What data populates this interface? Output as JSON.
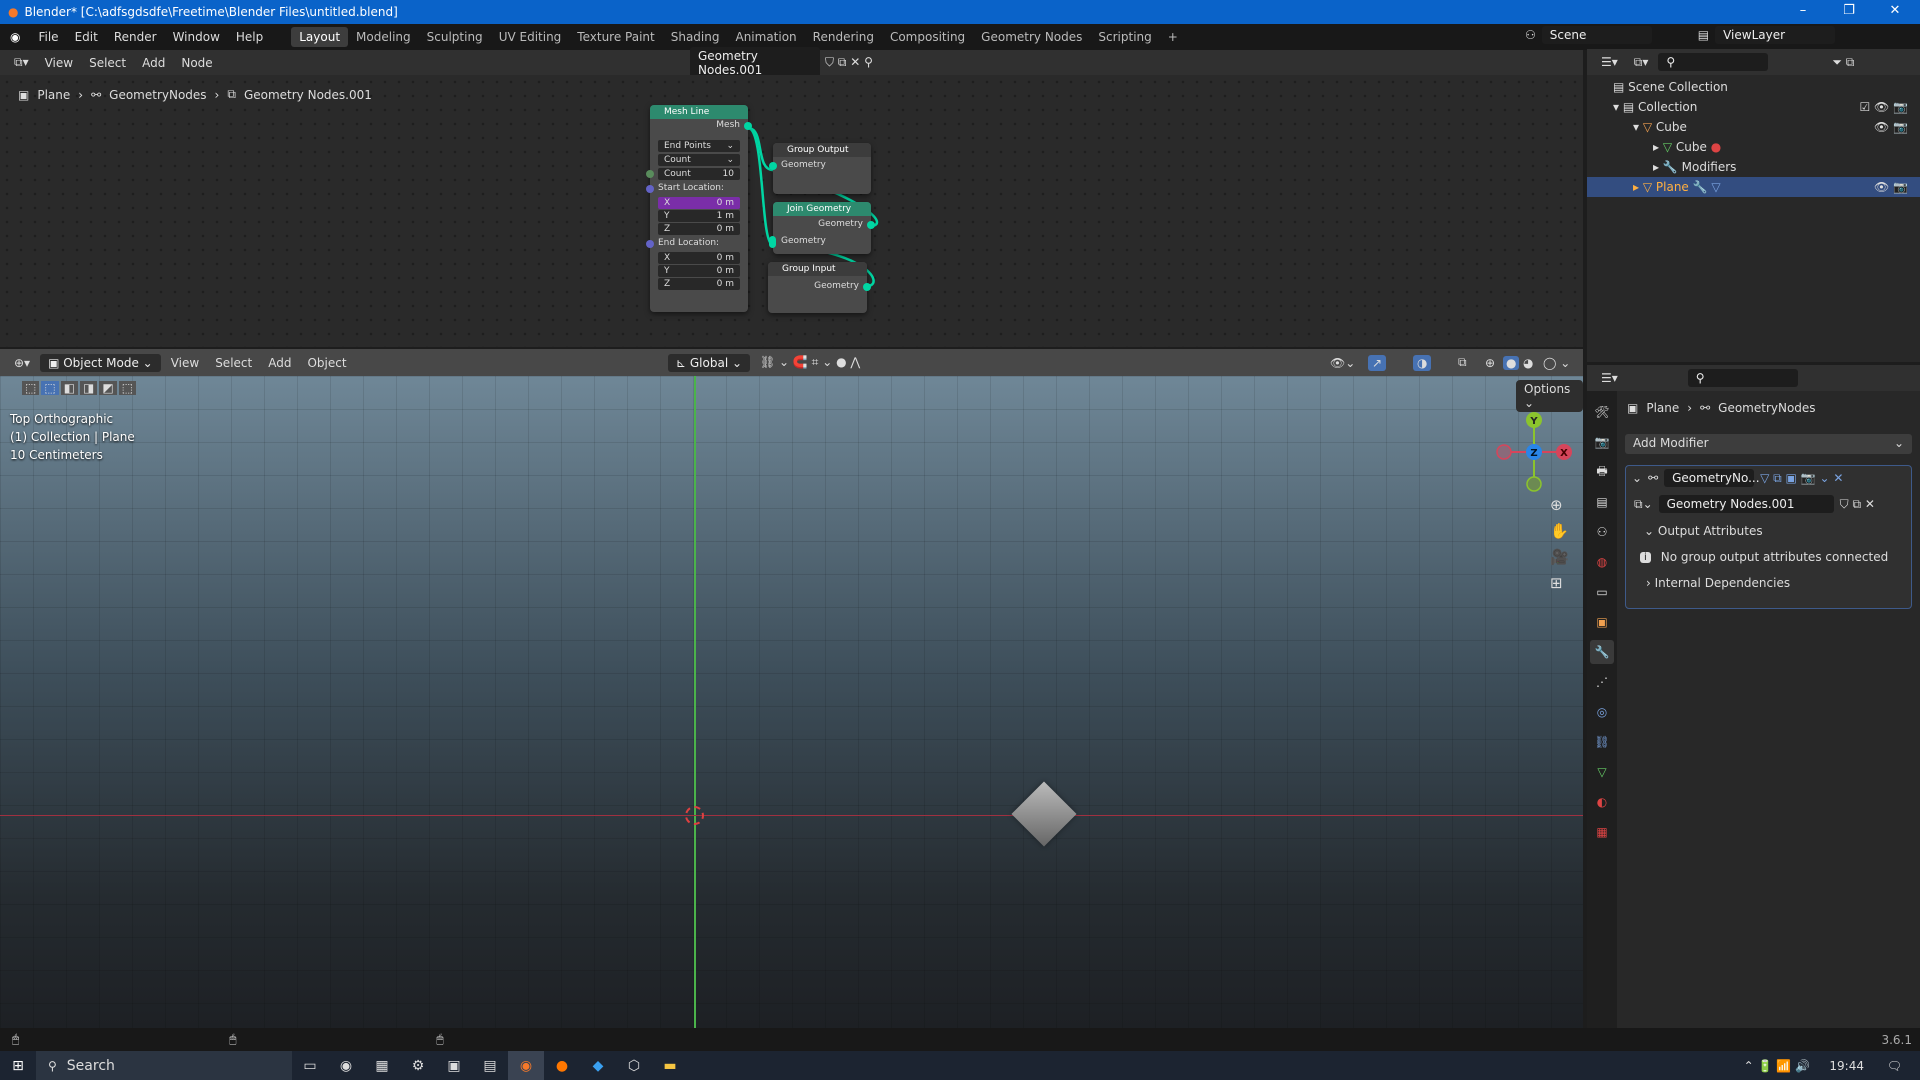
{
  "title": "Blender* [C:\\adfsgdsdfe\\Freetime\\Blender Files\\untitled.blend]",
  "menus": [
    "File",
    "Edit",
    "Render",
    "Window",
    "Help"
  ],
  "workspaces": [
    "Layout",
    "Modeling",
    "Sculpting",
    "UV Editing",
    "Texture Paint",
    "Shading",
    "Animation",
    "Rendering",
    "Compositing",
    "Geometry Nodes",
    "Scripting"
  ],
  "active_workspace": "Layout",
  "scene": "Scene",
  "view_layer": "ViewLayer",
  "node_editor": {
    "menus": [
      "View",
      "Select",
      "Add",
      "Node"
    ],
    "node_tree": "Geometry Nodes.001",
    "breadcrumb": [
      "Plane",
      "GeometryNodes",
      "Geometry Nodes.001"
    ],
    "mesh_line": {
      "title": "Mesh Line",
      "out": "Mesh",
      "mode": "End Points",
      "count_mode": "Count",
      "count_label": "Count",
      "count": "10",
      "start": "Start Location:",
      "end": "End Location:",
      "start_vals": [
        [
          "X",
          "0 m"
        ],
        [
          "Y",
          "1 m"
        ],
        [
          "Z",
          "0 m"
        ]
      ],
      "end_vals": [
        [
          "X",
          "0 m"
        ],
        [
          "Y",
          "0 m"
        ],
        [
          "Z",
          "0 m"
        ]
      ]
    },
    "group_output": {
      "title": "Group Output",
      "in": "Geometry"
    },
    "join_geometry": {
      "title": "Join Geometry",
      "out": "Geometry",
      "in": "Geometry"
    },
    "group_input": {
      "title": "Group Input",
      "out": "Geometry"
    },
    "colors": {
      "geometry_header": "#2d8a6e",
      "io_header": "#3c3c3c",
      "geometry_socket": "#00d6a3",
      "selected_field": "#7a2ea8"
    }
  },
  "viewport": {
    "mode": "Object Mode",
    "menus": [
      "View",
      "Select",
      "Add",
      "Object"
    ],
    "orientation": "Global",
    "options": "Options",
    "info": [
      "Top Orthographic",
      "(1) Collection | Plane",
      "10 Centimeters"
    ],
    "gizmo": {
      "x": "X",
      "y": "Y",
      "z": "Z"
    }
  },
  "outliner": {
    "items": [
      {
        "label": "Scene Collection"
      },
      {
        "label": "Collection"
      },
      {
        "label": "Cube"
      },
      {
        "label": "Cube"
      },
      {
        "label": "Modifiers"
      },
      {
        "label": "Plane",
        "selected": true
      }
    ]
  },
  "properties": {
    "breadcrumb": [
      "Plane",
      "GeometryNodes"
    ],
    "add_modifier": "Add Modifier",
    "modifier_name": "GeometryNo...",
    "node_group": "Geometry Nodes.001",
    "output_attributes": "Output Attributes",
    "info": "No group output attributes connected",
    "internal_deps": "Internal Dependencies"
  },
  "status": {
    "version": "3.6.1"
  },
  "taskbar": {
    "search": "Search",
    "time": "19:44"
  }
}
